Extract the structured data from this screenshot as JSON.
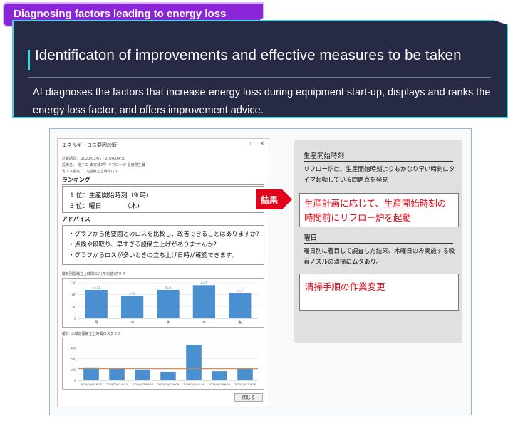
{
  "tag_label": "Diagnosing factors leading to energy loss",
  "hero": {
    "title": "Identificaton of improvements and effective measures to be taken",
    "description": "AI diagnoses the factors that increase energy loss during equipment start-up, displays and ranks the energy loss factor, and offers improvement advice."
  },
  "window": {
    "title": "エネルギーロス要因診断",
    "meta": [
      "診断期間： 2020/03/01 - 2020/04/30",
      "設備名： 電子工_東実装2号_リフロー炉-温度発生器",
      "省エネ視点： [1]設備立上時間ロス"
    ],
    "ranking_label": "ランキング",
    "ranking_items": [
      "1 位：生産開始時刻（9 時）",
      "3 位：曜日　　　　（木)"
    ],
    "advice_label": "アドバイス",
    "advice_items": [
      "・グラフから他要因とのロスを比較し、改善できることはありますか?",
      "・点検や段取り、早すぎる設備立上げがありませんか?",
      "・グラフからロスが多いときの立ち上げ日時が確認できます。"
    ],
    "chart1_label": "曜日別設備立上時間ロス(平均値)グラフ",
    "chart2_label": "曜日_木曜定設備立上時間ロスグラフ",
    "close_label": "閉じる"
  },
  "arrow_label": "結果",
  "panel": {
    "section1_title": "生産開始時刻",
    "section1_text": "リフロー炉は、生産開始時刻よりもかなり早い時刻にタイマ起動している問題点を発見",
    "section1_advice": "生産計画に応じて、生産開始時刻の時間前にリフロー炉を起動",
    "section2_title": "曜日",
    "section2_text": "曜日別に着目して調査した結果、木曜日のみ実施する吸着ノズルの清掃にムダあり。",
    "section2_advice": "清掃手順の作業変更"
  },
  "chart_data": [
    {
      "type": "bar",
      "categories": [
        "月",
        "火",
        "水",
        "木",
        "金"
      ],
      "values": [
        120,
        95,
        120,
        140,
        105
      ],
      "data_labels": [
        "n=11",
        "n=8",
        "n=8",
        "n=7",
        "n=7"
      ],
      "y_ticks": [
        "0",
        "50",
        "100",
        "150"
      ],
      "ylim": [
        0,
        150
      ],
      "bar_color": "#4a90d0"
    },
    {
      "type": "bar",
      "categories": [
        "2020/03/05 6:37",
        "2020/03/12 6:27",
        "2020/03/26 6:59",
        "2020/04/02 6:08",
        "2020/04/09 6:36",
        "2020/04/16 6:26",
        "2020/04/23 6:26"
      ],
      "x_labels": [
        "2020/03/05 6:37",
        "2020/03/12 6:27",
        "2020/03/26 6:59",
        "2020/04/02 6:08",
        "2020/04/09 6:36",
        "2020/04/16 6:26",
        "2020/04/23 6:26"
      ],
      "values": [
        120,
        110,
        100,
        80,
        330,
        85,
        110
      ],
      "reference_line": 108,
      "y_ticks": [
        "0",
        "100",
        "200",
        "300"
      ],
      "ylim": [
        0,
        350
      ],
      "bar_color": "#4a90d0",
      "line_color": "#f07a1a"
    }
  ]
}
